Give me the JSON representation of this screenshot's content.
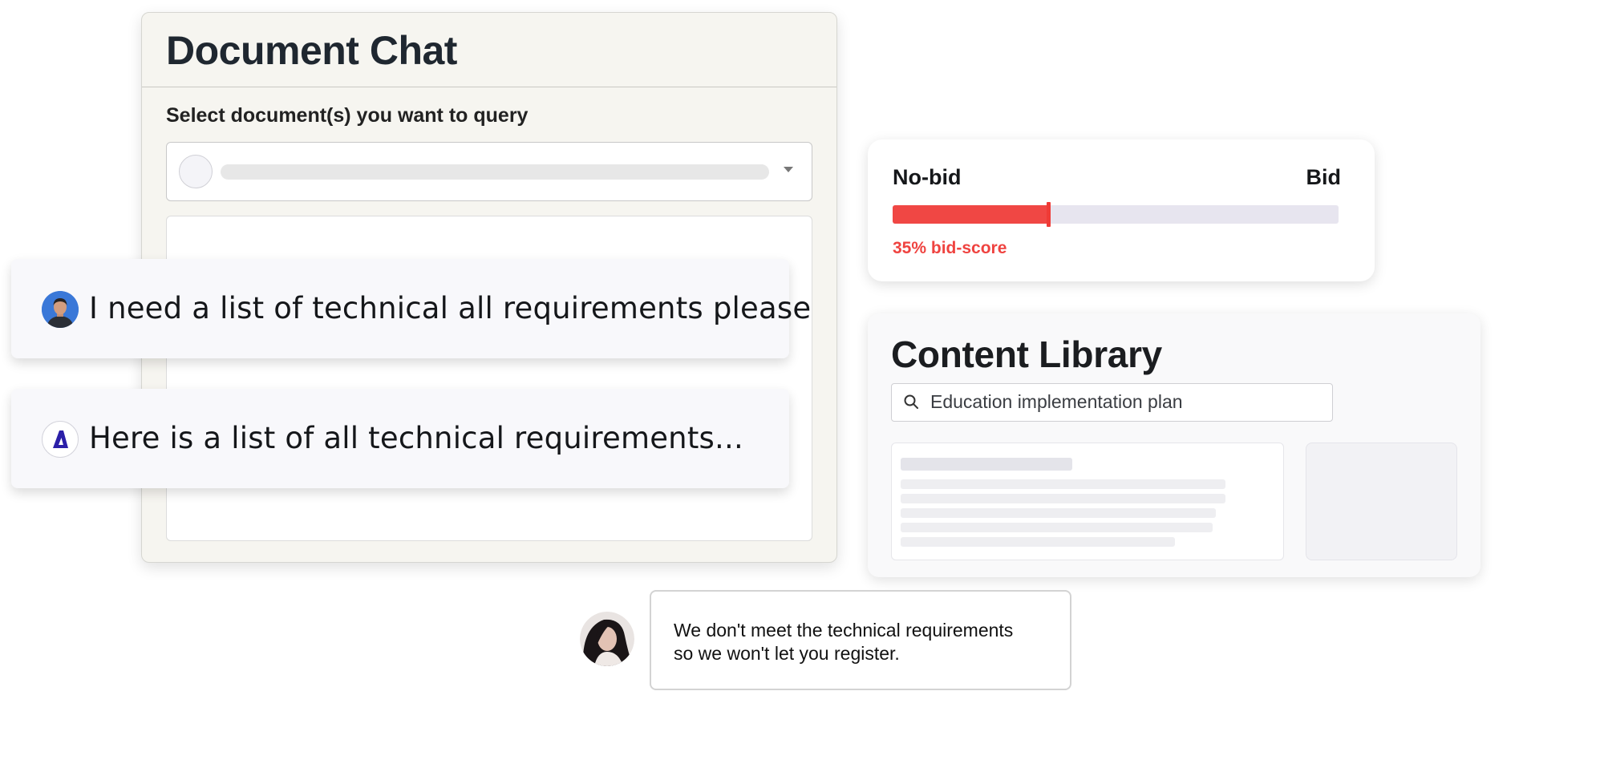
{
  "document_chat": {
    "title": "Document Chat",
    "select_label": "Select document(s) you want to query"
  },
  "chat": {
    "user_message": "I need a list of technical all requirements please",
    "bot_message": "Here is a list of all technical requirements...",
    "bot_logo_letter": "A"
  },
  "bid": {
    "left_label": "No-bid",
    "right_label": "Bid",
    "score_percent": 35,
    "score_text": "35% bid-score",
    "colors": {
      "fill": "#f04744",
      "track": "#e7e5ef",
      "text": "#ef4340"
    }
  },
  "content_library": {
    "title": "Content Library",
    "search_value": "Education implementation plan"
  },
  "comment": {
    "line1": "We don't meet the technical requirements",
    "line2": "so we won't let you register."
  }
}
